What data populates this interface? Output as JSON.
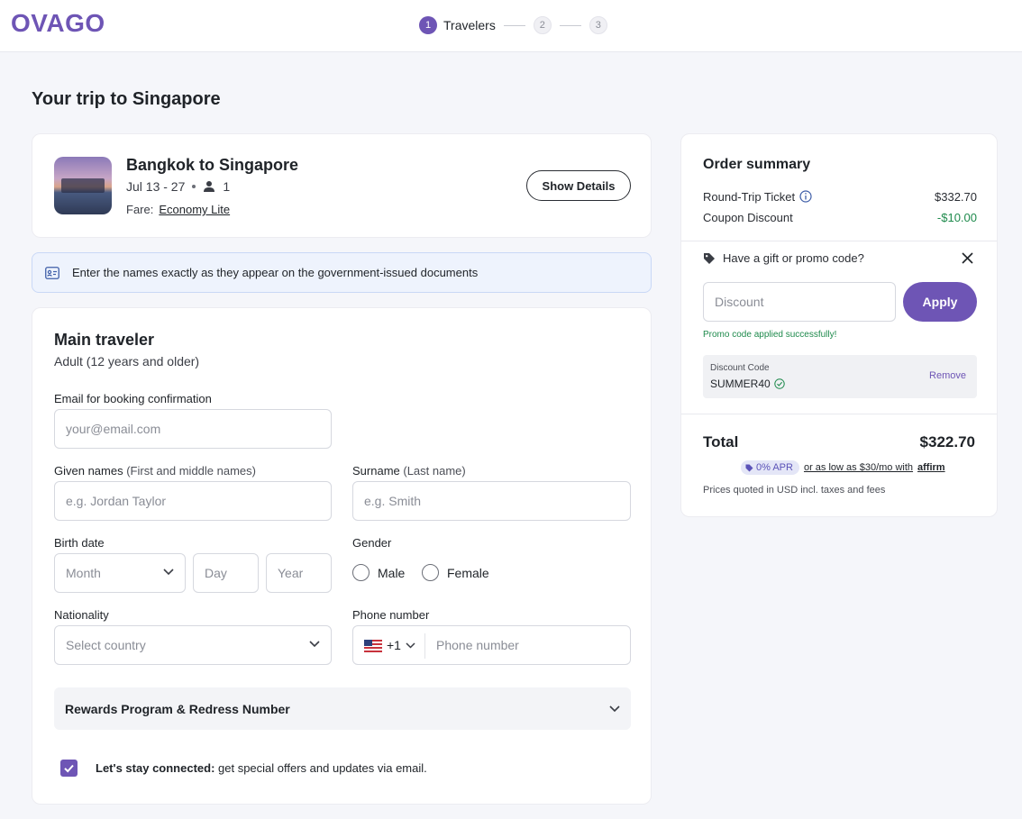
{
  "brand": {
    "logo": "OVAGO",
    "accent": "#6e55b5"
  },
  "stepper": [
    {
      "num": "1",
      "label": "Travelers",
      "active": true
    },
    {
      "num": "2",
      "label": "",
      "active": false
    },
    {
      "num": "3",
      "label": "",
      "active": false
    }
  ],
  "page_title": "Your trip to Singapore",
  "trip": {
    "title": "Bangkok to Singapore",
    "dates": "Jul 13 - 27",
    "travelers": "1",
    "fare_label": "Fare:",
    "fare_name": "Economy Lite",
    "details_button": "Show Details"
  },
  "notice": "Enter the names exactly as they appear on the government-issued documents",
  "traveler": {
    "title": "Main traveler",
    "subtitle": "Adult (12 years and older)",
    "email_label": "Email for booking confirmation",
    "email_placeholder": "your@email.com",
    "given_label": "Given names",
    "given_hint": "(First and middle names)",
    "given_placeholder": "e.g. Jordan Taylor",
    "surname_label": "Surname",
    "surname_hint": "(Last name)",
    "surname_placeholder": "e.g. Smith",
    "birth_label": "Birth date",
    "month_placeholder": "Month",
    "day_placeholder": "Day",
    "year_placeholder": "Year",
    "gender_label": "Gender",
    "gender_male": "Male",
    "gender_female": "Female",
    "nationality_label": "Nationality",
    "nationality_placeholder": "Select country",
    "phone_label": "Phone number",
    "phone_code": "+1",
    "phone_placeholder": "Phone number",
    "rewards_label": "Rewards Program & Redress Number",
    "consent_bold": "Let's stay connected:",
    "consent_text": " get special offers and updates via email.",
    "consent_checked": true
  },
  "summary": {
    "title": "Order summary",
    "ticket_label": "Round-Trip Ticket",
    "ticket_value": "$332.70",
    "coupon_label": "Coupon Discount",
    "coupon_value": "-$10.00",
    "promo_question": "Have a gift or promo code?",
    "discount_placeholder": "Discount",
    "apply_button": "Apply",
    "promo_success": "Promo code applied successfully!",
    "code_label": "Discount Code",
    "code_value": "SUMMER40",
    "remove_link": "Remove",
    "total_label": "Total",
    "total_value": "$322.70",
    "apr_badge": "0% APR",
    "affirm_text": "or as low as $30/mo with",
    "affirm_brand": "affirm",
    "fine_print": "Prices quoted in USD incl. taxes and fees"
  }
}
